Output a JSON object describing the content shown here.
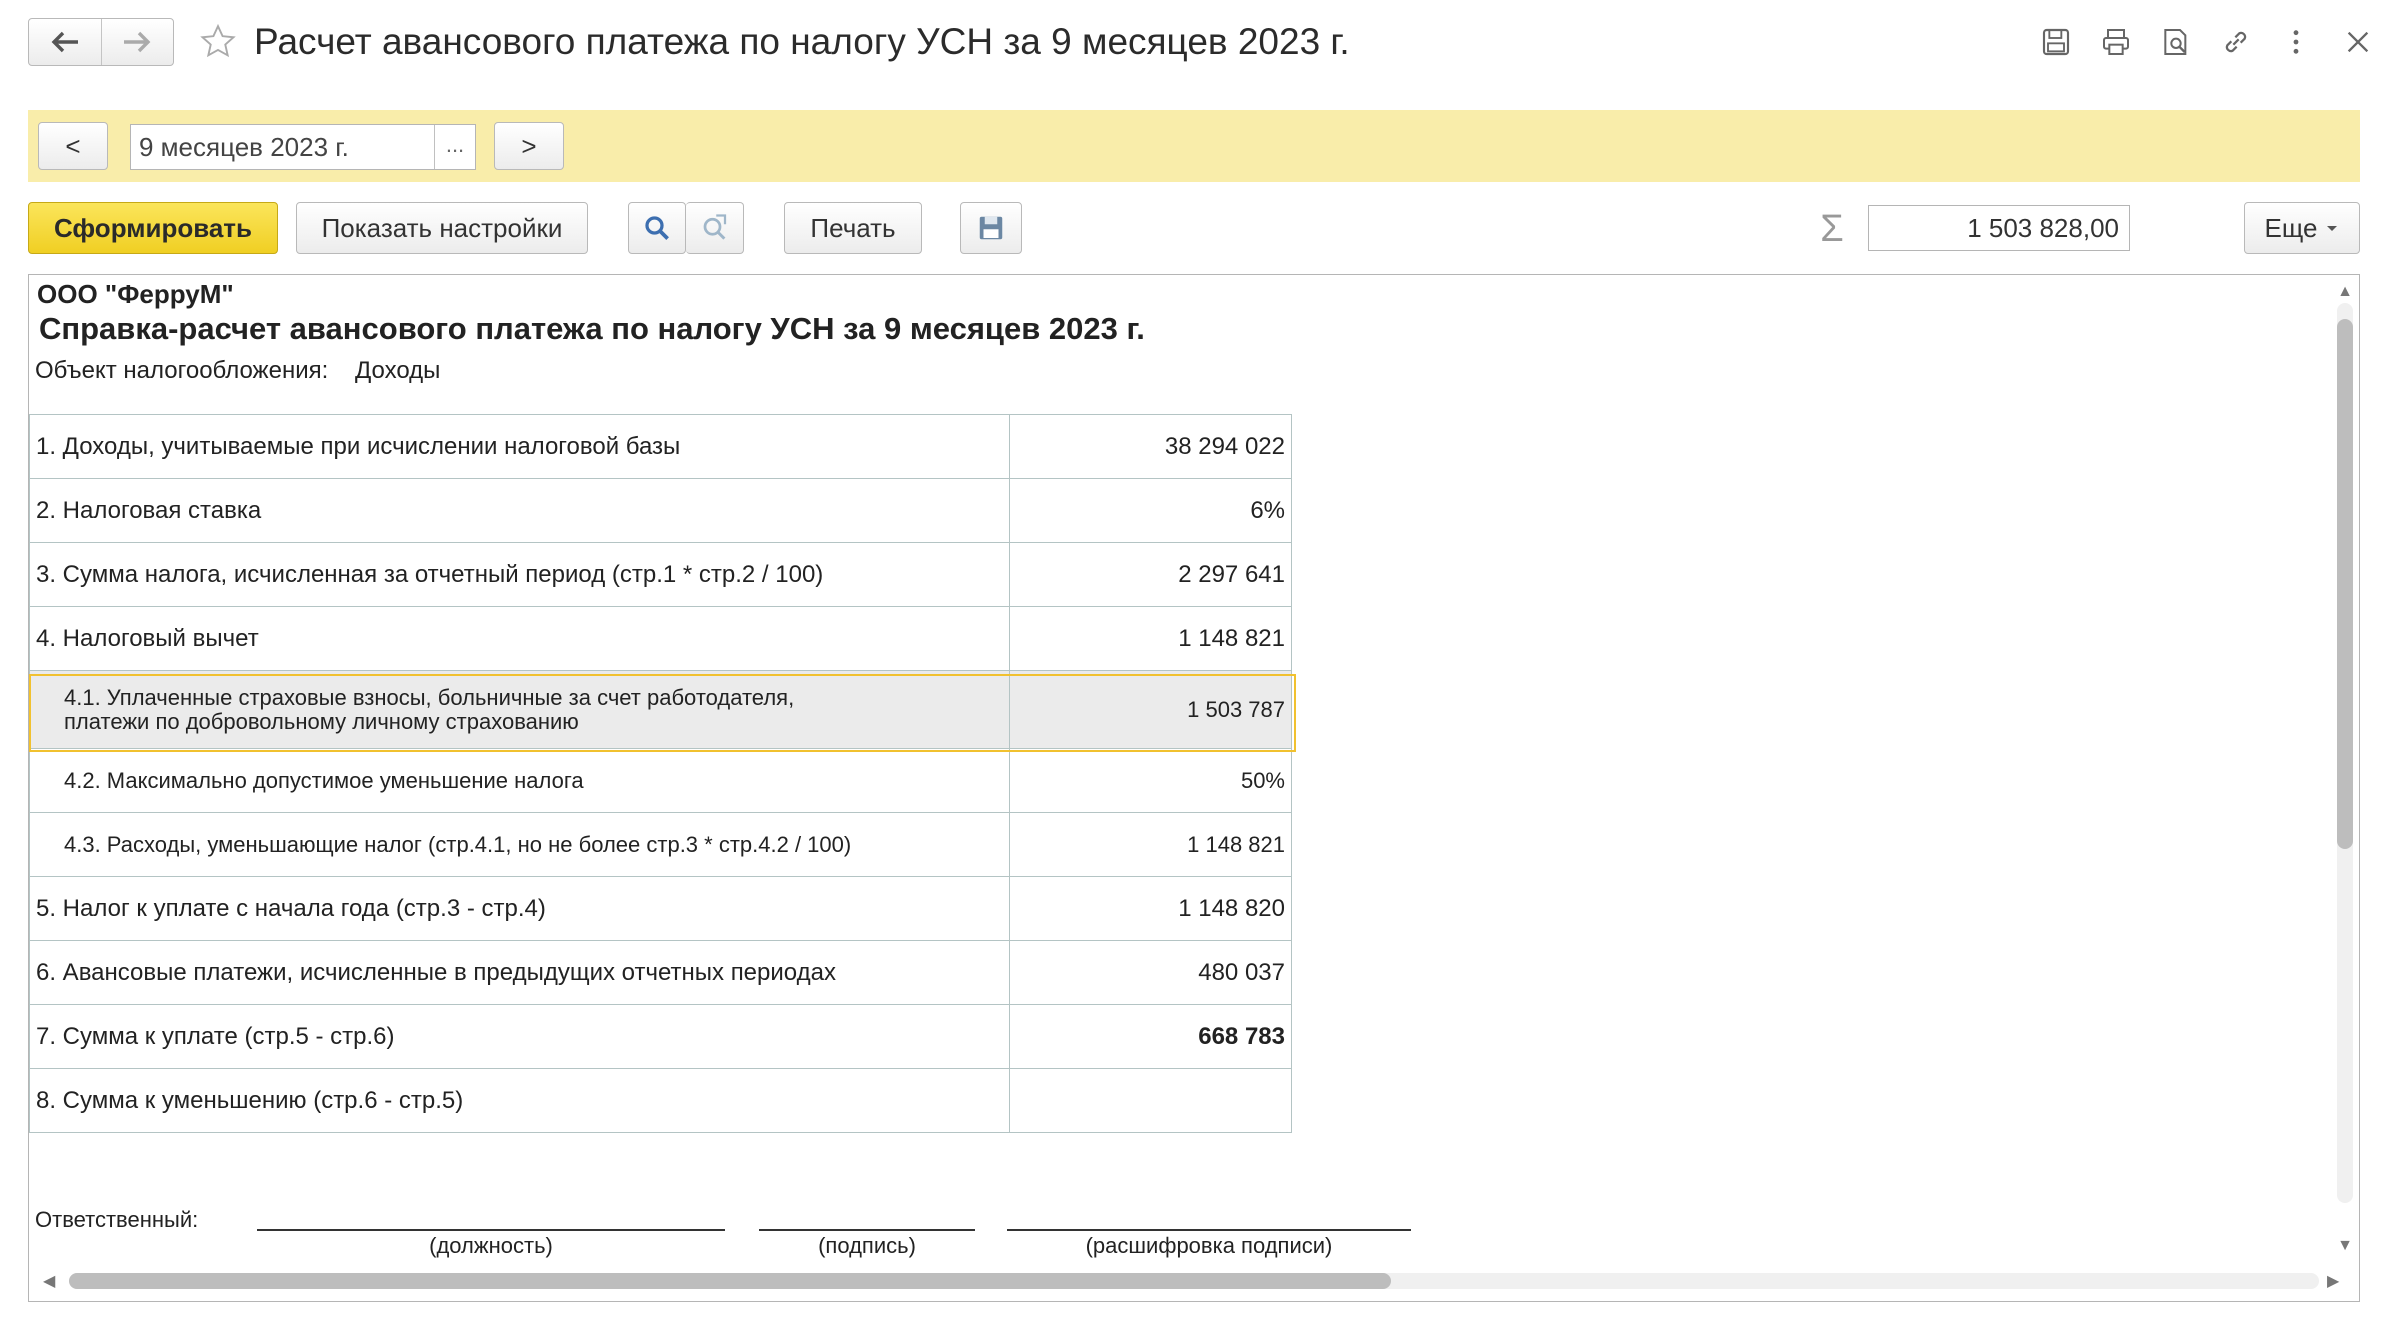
{
  "window": {
    "title": "Расчет авансового платежа по налогу УСН за 9 месяцев 2023 г.",
    "icons": [
      "back-arrow-icon",
      "forward-arrow-icon",
      "star-icon",
      "save-icon",
      "print-icon",
      "preview-icon",
      "link-icon",
      "more-icon",
      "close-icon"
    ]
  },
  "period": {
    "prev_label": "<",
    "value": "9 месяцев 2023 г.",
    "choose_label": "...",
    "next_label": ">"
  },
  "toolbar": {
    "generate_label": "Сформировать",
    "settings_label": "Показать настройки",
    "print_label": "Печать",
    "sum_symbol": "Σ",
    "sum_value": "1 503 828,00",
    "more_label": "Еще"
  },
  "report": {
    "company": "ООО \"ФерруМ\"",
    "heading": "Справка-расчет авансового платежа по налогу УСН за 9 месяцев 2023 г.",
    "object_label": "Объект налогообложения:",
    "object_value": "Доходы",
    "rows": [
      {
        "label": "1. Доходы, учитываемые при исчислении налоговой базы",
        "value": "38 294 022"
      },
      {
        "label": "2. Налоговая ставка",
        "value": "6%"
      },
      {
        "label": "3. Сумма налога, исчисленная за отчетный период (стр.1 * стр.2 / 100)",
        "value": "2 297 641"
      },
      {
        "label": "4. Налоговый вычет",
        "value": "1 148 821"
      },
      {
        "label_line1": "4.1. Уплаченные страховые взносы, больничные за счет работодателя,",
        "label_line2": "платежи по добровольному личному страхованию",
        "value": "1 503 787"
      },
      {
        "label": "4.2. Максимально допустимое уменьшение налога",
        "value": "50%"
      },
      {
        "label": "4.3. Расходы, уменьшающие налог (стр.4.1, но не более стр.3 * стр.4.2 / 100)",
        "value": "1 148 821"
      },
      {
        "label": "5. Налог к уплате с начала года (стр.3 - стр.4)",
        "value": "1 148 820"
      },
      {
        "label": "6. Авансовые платежи, исчисленные в предыдущих отчетных периодах",
        "value": "480 037"
      },
      {
        "label": "7. Сумма к уплате (стр.5 - стр.6)",
        "value": "668 783"
      },
      {
        "label": "8. Сумма к уменьшению (стр.6 - стр.5)",
        "value": ""
      }
    ],
    "signature": {
      "responsible_label": "Ответственный:",
      "position_caption": "(должность)",
      "signature_caption": "(подпись)",
      "decoding_caption": "(расшифровка подписи)"
    }
  },
  "colors": {
    "accent_yellow": "#f0cf23",
    "band": "#f9edaa",
    "highlight_border": "#f1c12f"
  }
}
